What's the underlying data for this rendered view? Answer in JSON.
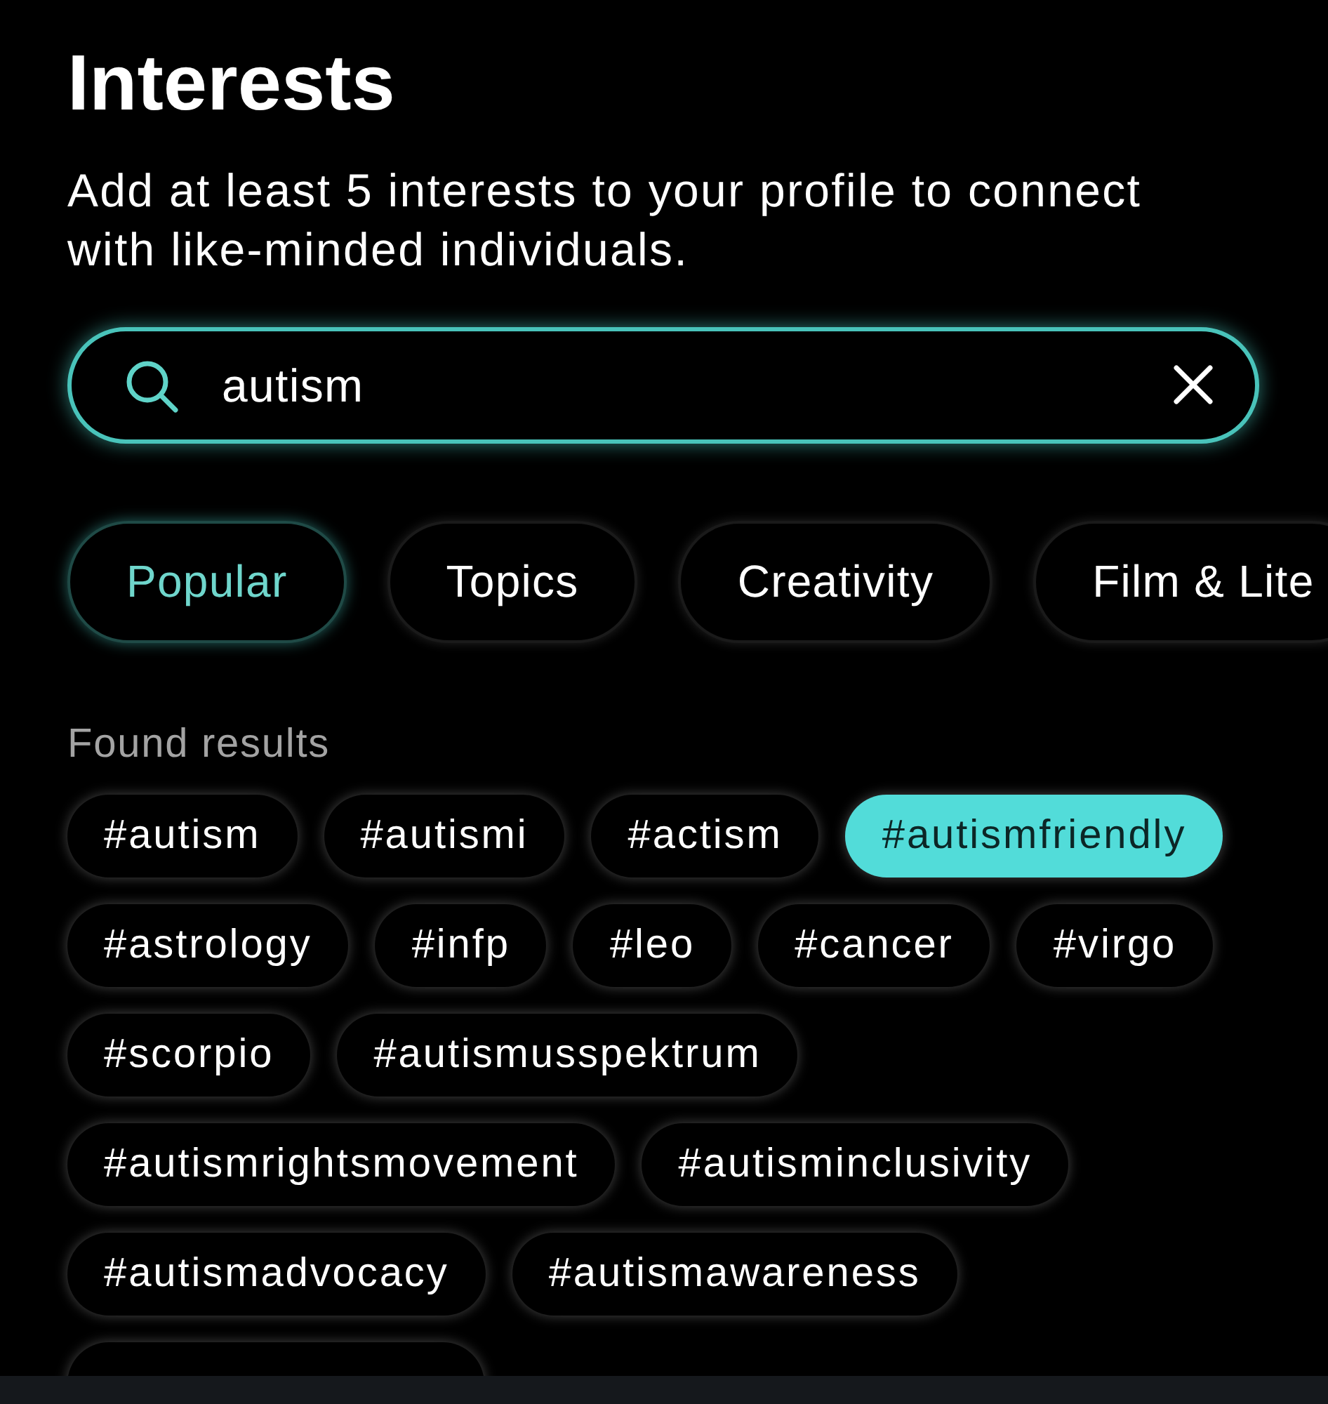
{
  "header": {
    "title": "Interests",
    "subtitle": "Add at least 5 interests to your profile to connect with like-minded individuals."
  },
  "search": {
    "value": "autism"
  },
  "categories": [
    {
      "label": "Popular",
      "selected": true
    },
    {
      "label": "Topics",
      "selected": false
    },
    {
      "label": "Creativity",
      "selected": false
    },
    {
      "label": "Film & Lite",
      "selected": false
    }
  ],
  "results": {
    "heading": "Found results",
    "rows": [
      {
        "tags": [
          {
            "label": "#autism",
            "selected": false
          },
          {
            "label": "#autismi",
            "selected": false
          },
          {
            "label": "#actism",
            "selected": false
          },
          {
            "label": "#autismfriendly",
            "selected": true
          }
        ]
      },
      {
        "tags": [
          {
            "label": "#astrology",
            "selected": false
          },
          {
            "label": "#infp",
            "selected": false
          },
          {
            "label": "#leo",
            "selected": false
          },
          {
            "label": "#cancer",
            "selected": false
          },
          {
            "label": "#virgo",
            "selected": false
          }
        ]
      },
      {
        "tags": [
          {
            "label": "#scorpio",
            "selected": false
          },
          {
            "label": "#autismusspektrum",
            "selected": false
          }
        ]
      },
      {
        "tags": [
          {
            "label": "#autismrightsmovement",
            "selected": false
          },
          {
            "label": "#autisminclusivity",
            "selected": false
          }
        ]
      },
      {
        "tags": [
          {
            "label": "#autismadvocacy",
            "selected": false
          },
          {
            "label": "#autismawareness",
            "selected": false
          }
        ]
      }
    ],
    "clipped_tag": true
  }
}
